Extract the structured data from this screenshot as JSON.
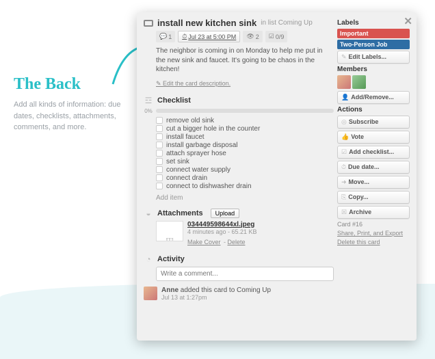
{
  "callout": {
    "title": "The Back",
    "text": "Add all kinds of information: due dates, checklists, attachments, comments, and more."
  },
  "card": {
    "title": "install new kitchen sink",
    "list_prefix": "in list",
    "list_name": "Coming Up",
    "badges": {
      "comments": "1",
      "due": "Jul 23 at 5:00 PM",
      "votes": "2",
      "checklist": "0/9"
    },
    "description": "The neighbor is coming in on Monday to help me put in the new sink and faucet. It's going to be chaos in the kitchen!",
    "edit_desc": "Edit the card description.",
    "checklist": {
      "title": "Checklist",
      "progress": "0%",
      "items": [
        "remove old sink",
        "cut a bigger hole in the counter",
        "install faucet",
        "install garbage disposal",
        "attach sprayer hose",
        "set sink",
        "connect water supply",
        "connect drain",
        "connect to dishwasher drain"
      ],
      "add": "Add item"
    },
    "attachments": {
      "title": "Attachments",
      "upload": "Upload",
      "file": {
        "name": "034449598644xl.jpeg",
        "meta": "4 minutes ago - 65.21 KB",
        "make_cover": "Make Cover",
        "delete": "Delete"
      }
    },
    "activity": {
      "title": "Activity",
      "placeholder": "Write a comment...",
      "entry": {
        "user": "Anne",
        "text": " added this card to Coming Up",
        "time": "Jul 13 at 1:27pm"
      }
    }
  },
  "side": {
    "labels": {
      "title": "Labels",
      "items": [
        {
          "text": "Important",
          "color": "red"
        },
        {
          "text": "Two-Person Job",
          "color": "blue"
        }
      ],
      "edit": "Edit Labels..."
    },
    "members": {
      "title": "Members",
      "add": "Add/Remove..."
    },
    "actions": {
      "title": "Actions",
      "items": [
        {
          "icon": "◎",
          "label": "Subscribe"
        },
        {
          "icon": "👍",
          "label": "Vote"
        },
        {
          "icon": "☑",
          "label": "Add checklist..."
        },
        {
          "icon": "⏱",
          "label": "Due date..."
        },
        {
          "icon": "➜",
          "label": "Move..."
        },
        {
          "icon": "⎘",
          "label": "Copy..."
        },
        {
          "icon": "☒",
          "label": "Archive"
        }
      ]
    },
    "footer": {
      "card_id": "Card #16",
      "share": "Share, Print, and Export",
      "delete": "Delete this card"
    }
  }
}
